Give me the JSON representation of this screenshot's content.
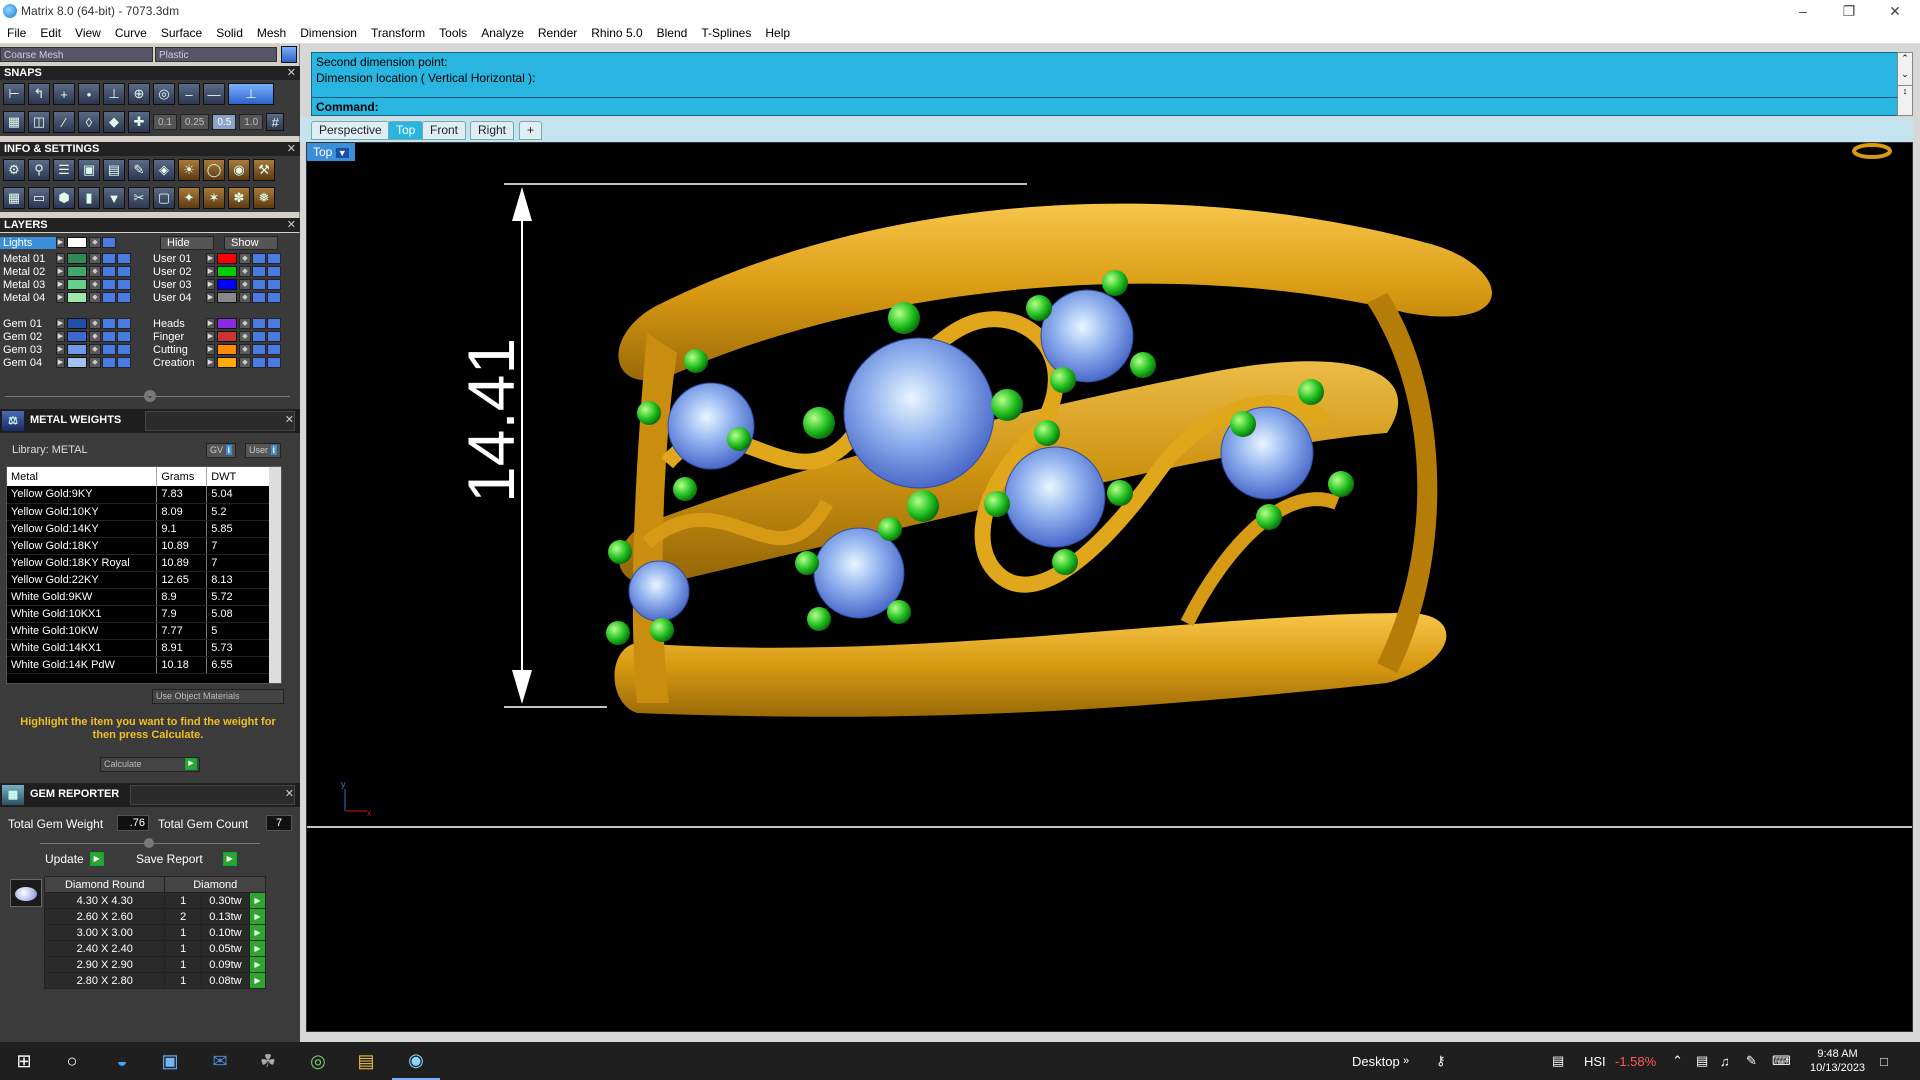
{
  "window": {
    "title": "Matrix 8.0 (64-bit) - 7073.3dm"
  },
  "menu": [
    "File",
    "Edit",
    "View",
    "Curve",
    "Surface",
    "Solid",
    "Mesh",
    "Dimension",
    "Transform",
    "Tools",
    "Analyze",
    "Render",
    "Rhino 5.0",
    "Blend",
    "T-Splines",
    "Help"
  ],
  "combos": {
    "mesh": "Coarse Mesh",
    "material": "Plastic"
  },
  "sections": {
    "snaps": "SNAPS",
    "info": "INFO & SETTINGS",
    "layers": "LAYERS",
    "metal": "METAL WEIGHTS",
    "gem": "GEM REPORTER"
  },
  "snap_values": [
    "0.1",
    "0.25",
    "0.5",
    "1.0"
  ],
  "layers": {
    "lights": "Lights",
    "hide": "Hide",
    "show": "Show",
    "left": [
      {
        "name": "Metal 01",
        "color": "#2e8b57"
      },
      {
        "name": "Metal 02",
        "color": "#3fa86a"
      },
      {
        "name": "Metal 03",
        "color": "#66d18a"
      },
      {
        "name": "Metal 04",
        "color": "#9ae8ae"
      },
      {
        "name": "Gem 01",
        "color": "#1f4fa8"
      },
      {
        "name": "Gem 02",
        "color": "#3a6ad0"
      },
      {
        "name": "Gem 03",
        "color": "#6f9ae6"
      },
      {
        "name": "Gem 04",
        "color": "#a3c2f2"
      }
    ],
    "right": [
      {
        "name": "User 01",
        "color": "#ff0000"
      },
      {
        "name": "User 02",
        "color": "#00cc00"
      },
      {
        "name": "User 03",
        "color": "#0000ff"
      },
      {
        "name": "User 04",
        "color": "#888888"
      },
      {
        "name": "Heads",
        "color": "#8a2be2"
      },
      {
        "name": "Finger",
        "color": "#cc3333"
      },
      {
        "name": "Cutting",
        "color": "#ff8c00"
      },
      {
        "name": "Creation",
        "color": "#ffaa00"
      }
    ]
  },
  "metal": {
    "library": "Library: METAL",
    "gv": "GV",
    "user": "User",
    "columns": [
      "Metal",
      "Grams",
      "DWT"
    ],
    "rows": [
      [
        "Yellow Gold:9KY",
        "7.83",
        "5.04"
      ],
      [
        "Yellow Gold:10KY",
        "8.09",
        "5.2"
      ],
      [
        "Yellow Gold:14KY",
        "9.1",
        "5.85"
      ],
      [
        "Yellow Gold:18KY",
        "10.89",
        "7"
      ],
      [
        "Yellow Gold:18KY Royal",
        "10.89",
        "7"
      ],
      [
        "Yellow Gold:22KY",
        "12.65",
        "8.13"
      ],
      [
        "White Gold:9KW",
        "8.9",
        "5.72"
      ],
      [
        "White Gold:10KX1",
        "7.9",
        "5.08"
      ],
      [
        "White Gold:10KW",
        "7.77",
        "5"
      ],
      [
        "White Gold:14KX1",
        "8.91",
        "5.73"
      ],
      [
        "White Gold:14K PdW",
        "10.18",
        "6.55"
      ]
    ],
    "use_object": "Use Object Materials",
    "hint": "Highlight the item you want to find the weight for then press Calculate.",
    "calculate": "Calculate"
  },
  "gem": {
    "total_weight_label": "Total Gem Weight",
    "total_weight": ".76",
    "total_count_label": "Total Gem Count",
    "total_count": "7",
    "update": "Update",
    "save_report": "Save Report",
    "columns": [
      "Diamond Round",
      "Diamond"
    ],
    "rows": [
      [
        "4.30 X 4.30",
        "1",
        "0.30tw"
      ],
      [
        "2.60 X 2.60",
        "2",
        "0.13tw"
      ],
      [
        "3.00 X 3.00",
        "1",
        "0.10tw"
      ],
      [
        "2.40 X 2.40",
        "1",
        "0.05tw"
      ],
      [
        "2.90 X 2.90",
        "1",
        "0.09tw"
      ],
      [
        "2.80 X 2.80",
        "1",
        "0.08tw"
      ]
    ]
  },
  "command": {
    "line1": "Second dimension point:",
    "line2": "Dimension location ( Vertical  Horizontal ):",
    "prompt": "Command:"
  },
  "viewtabs": [
    "Perspective",
    "Top",
    "Front",
    "Right",
    "+"
  ],
  "viewport": {
    "label": "Top",
    "dimension": "14.41"
  },
  "taskbar": {
    "desktop": "Desktop",
    "hsi": "HSI",
    "hsi_change": "-1.58%",
    "time": "9:48 AM",
    "date": "10/13/2023"
  }
}
